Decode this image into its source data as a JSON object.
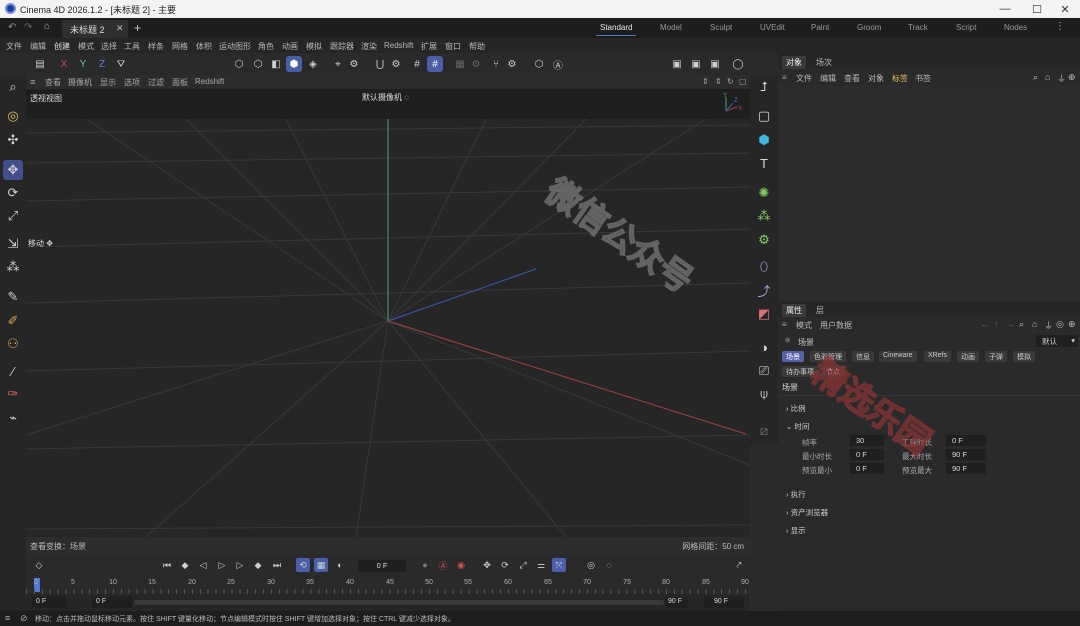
{
  "window": {
    "title": "Cinema 4D 2026.1.2 - [未标题 2] - 主要",
    "min_glyph": "—",
    "max_glyph": "☐",
    "close_glyph": "✕"
  },
  "doc_tab": {
    "label": "未标题 2",
    "close": "✕",
    "add": "+"
  },
  "workspaces": [
    "Standard",
    "Model",
    "Sculpt",
    "UVEdit",
    "Paint",
    "Groom",
    "Track",
    "Script",
    "Nodes"
  ],
  "menu": [
    "文件",
    "编辑",
    "创建",
    "模式",
    "选择",
    "工具",
    "样条",
    "网格",
    "体积",
    "运动图形",
    "角色",
    "动画",
    "模拟",
    "跟踪器",
    "渲染",
    "Redshift",
    "扩展",
    "窗口",
    "帮助"
  ],
  "axis_toggles": [
    "X",
    "Y",
    "Z"
  ],
  "viewport": {
    "menu": [
      "查看",
      "摄像机",
      "显示",
      "选项",
      "过滤",
      "面板",
      "Redshift"
    ],
    "name": "透视视图",
    "camera": "默认摄像机",
    "camera_icon": "◌",
    "move_hint": "移动",
    "status_left": "查看变换：场景",
    "status_right": "网格间距：50 cm"
  },
  "object_manager": {
    "tabs": [
      "对象",
      "场次"
    ],
    "menu": [
      "文件",
      "编辑",
      "查看",
      "对象",
      "标签",
      "书签"
    ]
  },
  "attribute_manager": {
    "tabs": [
      "属性",
      "层"
    ],
    "menu": [
      "模式",
      "用户数据"
    ],
    "path": "场景",
    "preset": "默认",
    "chips": [
      "场景",
      "色彩管理",
      "信息",
      "Cineware",
      "XRefs",
      "动画",
      "子弹",
      "模拟",
      "待办事项",
      "节点"
    ],
    "section_title": "场景",
    "groups": {
      "ratio": "比例",
      "time": "时间",
      "exec": "执行",
      "asset": "资产浏览器",
      "display": "显示"
    },
    "fields": {
      "fps": {
        "label": "帧率",
        "value": "30"
      },
      "project_length": {
        "label": "工程时长",
        "value": "0 F"
      },
      "min_length": {
        "label": "最小时长",
        "value": "0 F"
      },
      "max_length": {
        "label": "最大时长",
        "value": "90 F"
      },
      "preview_min": {
        "label": "预览最小",
        "value": "0 F"
      },
      "preview_max": {
        "label": "预览最大",
        "value": "90 F"
      }
    }
  },
  "timeline": {
    "current_frame": "0 F",
    "ticks": [
      "0",
      "5",
      "10",
      "15",
      "20",
      "25",
      "30",
      "35",
      "40",
      "45",
      "50",
      "55",
      "60",
      "65",
      "70",
      "75",
      "80",
      "85",
      "90"
    ],
    "start": "0 F",
    "preview_start": "0 F",
    "preview_end": "90 F",
    "end": "90 F"
  },
  "status": {
    "text": "移动：点击并拖动鼠标移动元素。按住 SHIFT 键量化移动；节点编辑模式时按住 SHIFT 键增加选择对象；按住 CTRL 键减少选择对象。"
  },
  "watermark": {
    "a": "微信公众号",
    "b": "精选乐园"
  },
  "colors": {
    "accent": "#4b7bd6",
    "selected_tool": "#41508c",
    "x_axis": "#c44a4a",
    "y_axis": "#44b07a",
    "z_axis": "#4a6ad0"
  }
}
